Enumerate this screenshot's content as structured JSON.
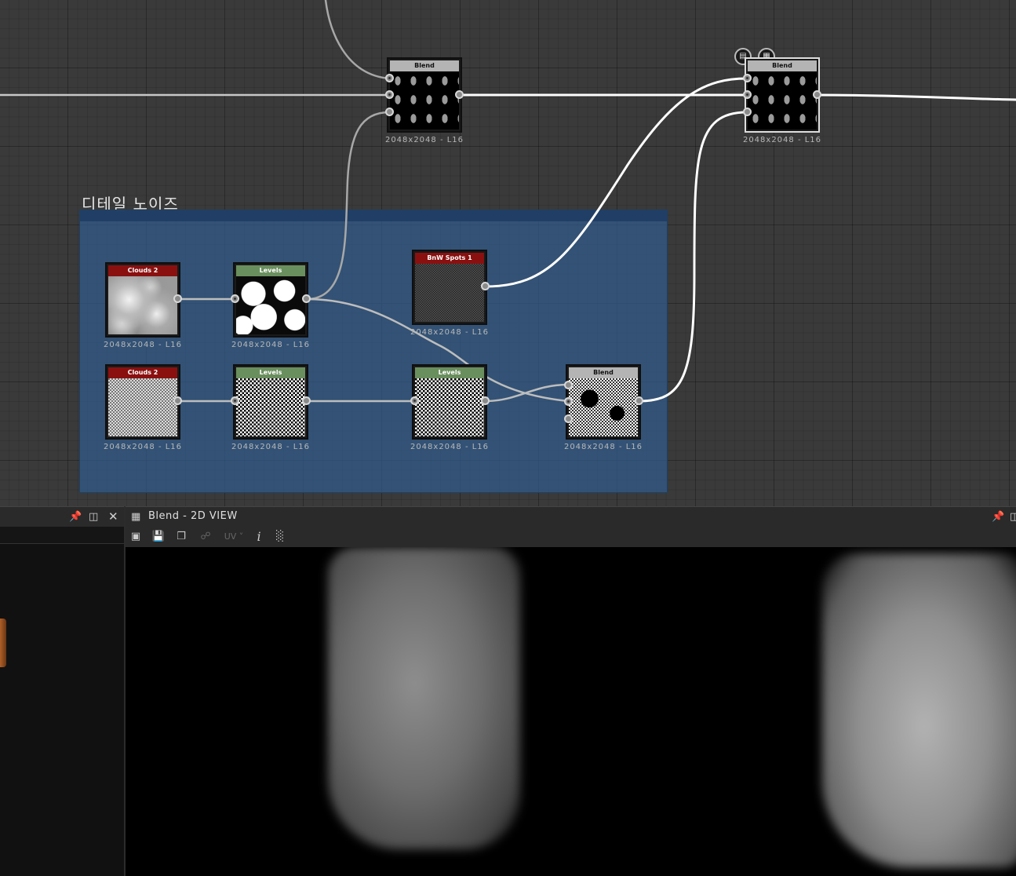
{
  "graph": {
    "frame_title": "디테일 노이즈",
    "nodes": [
      {
        "id": "blend_top_1",
        "title": "Blend",
        "resolution": "2048x2048 - L16"
      },
      {
        "id": "blend_top_2",
        "title": "Blend",
        "resolution": "2048x2048 - L16"
      },
      {
        "id": "clouds_1",
        "title": "Clouds 2",
        "resolution": "2048x2048 - L16"
      },
      {
        "id": "levels_1",
        "title": "Levels",
        "resolution": "2048x2048 - L16"
      },
      {
        "id": "bnw_spots",
        "title": "BnW Spots 1",
        "resolution": "2048x2048 - L16"
      },
      {
        "id": "clouds_2",
        "title": "Clouds 2",
        "resolution": "2048x2048 - L16"
      },
      {
        "id": "levels_2",
        "title": "Levels",
        "resolution": "2048x2048 - L16"
      },
      {
        "id": "levels_3",
        "title": "Levels",
        "resolution": "2048x2048 - L16"
      },
      {
        "id": "blend_frame",
        "title": "Blend",
        "resolution": "2048x2048 - L16"
      }
    ],
    "header_colors": {
      "generator": "#8a1010",
      "filter": "#6a8f5e",
      "blend": "#b4b4b4"
    },
    "selected_node": "blend_top_2",
    "node_badges": [
      "document-icon",
      "checker-icon"
    ]
  },
  "view2d": {
    "title": "Blend - 2D VIEW",
    "toolbar": {
      "uv_label": "UV",
      "icons": [
        "display-icon",
        "save-icon",
        "copy-icon",
        "graph-icon",
        "info-icon",
        "histogram-icon"
      ]
    }
  },
  "left_panel": {
    "icons": [
      "pin-icon",
      "float-icon",
      "close-icon"
    ]
  }
}
